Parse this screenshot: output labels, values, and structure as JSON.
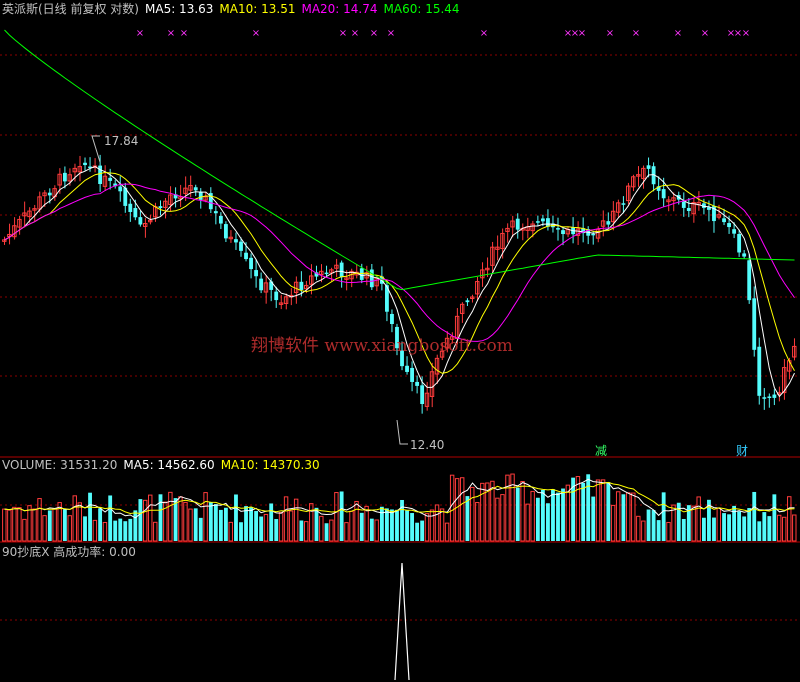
{
  "main_header": {
    "title": "英派斯(日线 前复权 对数)",
    "ma5": "MA5: 13.63",
    "ma10": "MA10: 13.51",
    "ma20": "MA20: 14.74",
    "ma60": "MA60: 15.44"
  },
  "volume_header": {
    "label": "VOLUME: 31531.20",
    "ma5": "MA5: 14562.60",
    "ma10": "MA10: 14370.30"
  },
  "indicator_header": {
    "label": "90抄底X 高成功率: 0.00"
  },
  "annotations": {
    "high_label": "17.84",
    "low_label": "12.40",
    "marker_jian": "减",
    "marker_cai": "财",
    "watermark": "翔博软件 www.xiangbosoft.com"
  },
  "colors": {
    "up": "#ff3c3c",
    "down": "#54fcfc",
    "ma5": "#ffffff",
    "ma10": "#ffff00",
    "ma20": "#ff00ff",
    "ma60": "#00ff00",
    "grid": "#8b0000",
    "header_text": "#c0c0c0"
  },
  "chart_data": {
    "type": "candlestick",
    "price_range": [
      12.0,
      19.5
    ],
    "high": 17.84,
    "low": 12.4,
    "last": {
      "close": 13.6
    },
    "indicator_value": 0.0
  }
}
